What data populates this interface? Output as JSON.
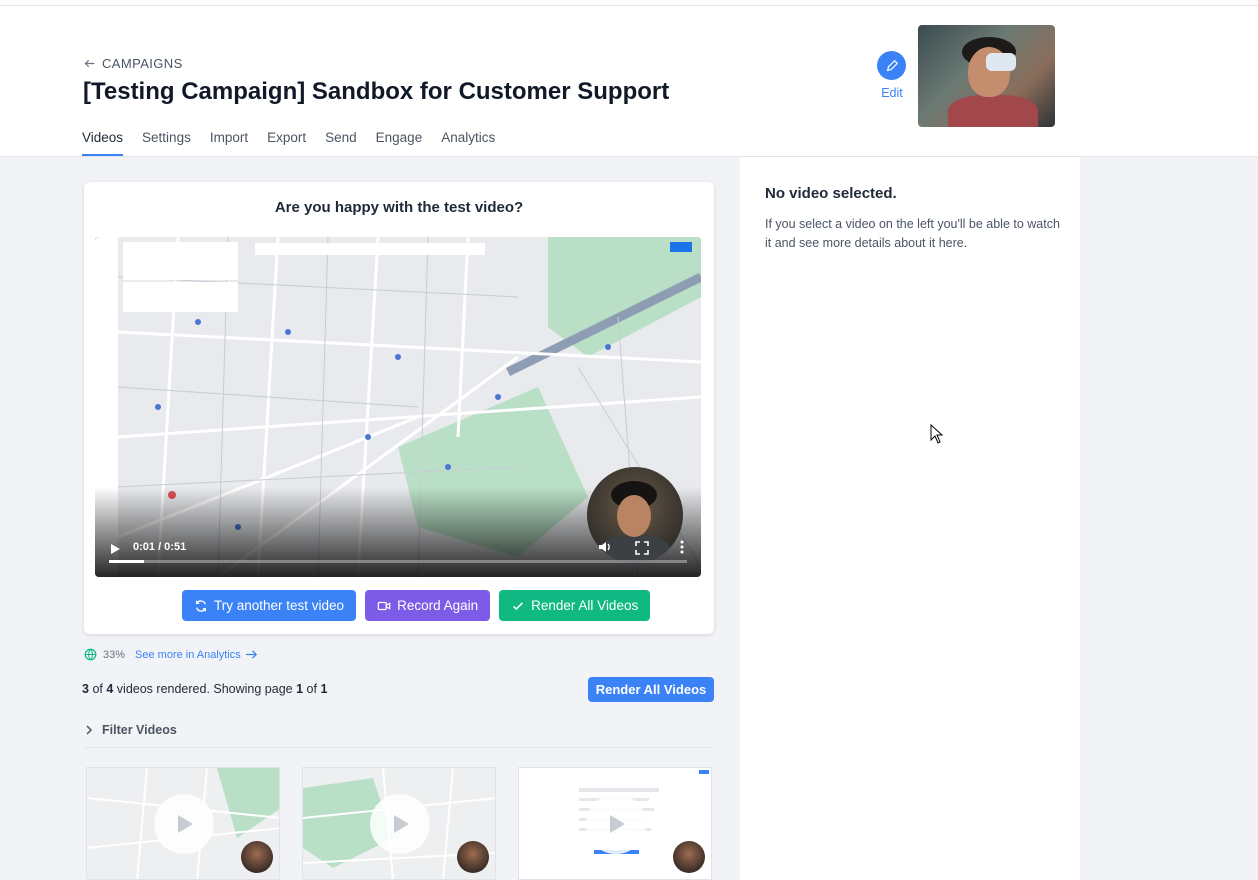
{
  "header": {
    "back_label": "CAMPAIGNS",
    "title": "[Testing Campaign] Sandbox for Customer Support",
    "edit_label": "Edit",
    "tabs": [
      {
        "label": "Videos",
        "active": true
      },
      {
        "label": "Settings",
        "active": false
      },
      {
        "label": "Import",
        "active": false
      },
      {
        "label": "Export",
        "active": false
      },
      {
        "label": "Send",
        "active": false
      },
      {
        "label": "Engage",
        "active": false
      },
      {
        "label": "Analytics",
        "active": false
      }
    ]
  },
  "test_video": {
    "question": "Are you happy with the test video?",
    "time": "0:01 / 0:51",
    "progress": 0.06,
    "buttons": {
      "try_another": "Try another test video",
      "record_again": "Record Again",
      "render_all": "Render All Videos"
    }
  },
  "stats": {
    "percent": "33%",
    "analytics_link": "See more in Analytics"
  },
  "render_status": {
    "rendered": "3",
    "of_text": "of",
    "total": "4",
    "mid_text": "videos rendered. Showing page",
    "page": "1",
    "of_text2": "of",
    "pages": "1",
    "button": "Render All Videos"
  },
  "filter": {
    "label": "Filter Videos"
  },
  "video_list": [
    {
      "icon": "play-icon"
    },
    {
      "icon": "play-icon"
    },
    {
      "icon": "play-icon"
    }
  ],
  "panel": {
    "title": "No video selected.",
    "text": "If you select a video on the left you'll be able to watch it and see more details about it here."
  },
  "colors": {
    "primary": "#3b82f6",
    "purple": "#7c5ce6",
    "green": "#10b981"
  }
}
